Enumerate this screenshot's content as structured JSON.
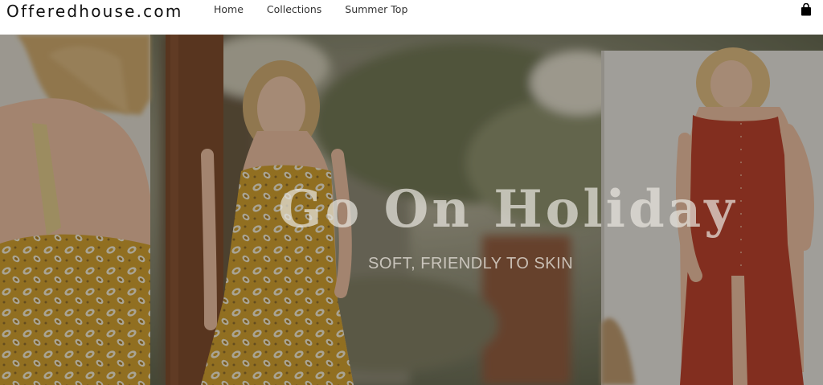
{
  "header": {
    "logo": "Offeredhouse.com",
    "nav": [
      {
        "label": "Home"
      },
      {
        "label": "Collections"
      },
      {
        "label": "Summer Top"
      }
    ],
    "cart_icon": "shopping-bag-icon"
  },
  "hero": {
    "title": "Go On Holiday",
    "subtitle": "SOFT, FRIENDLY TO SKIN",
    "colors": {
      "paisley_dress": "#c99a2e",
      "red_dress": "#b4412b",
      "palm_trunk": "#7a4a2c",
      "overlay": "rgba(0,0,0,0.28)"
    }
  }
}
